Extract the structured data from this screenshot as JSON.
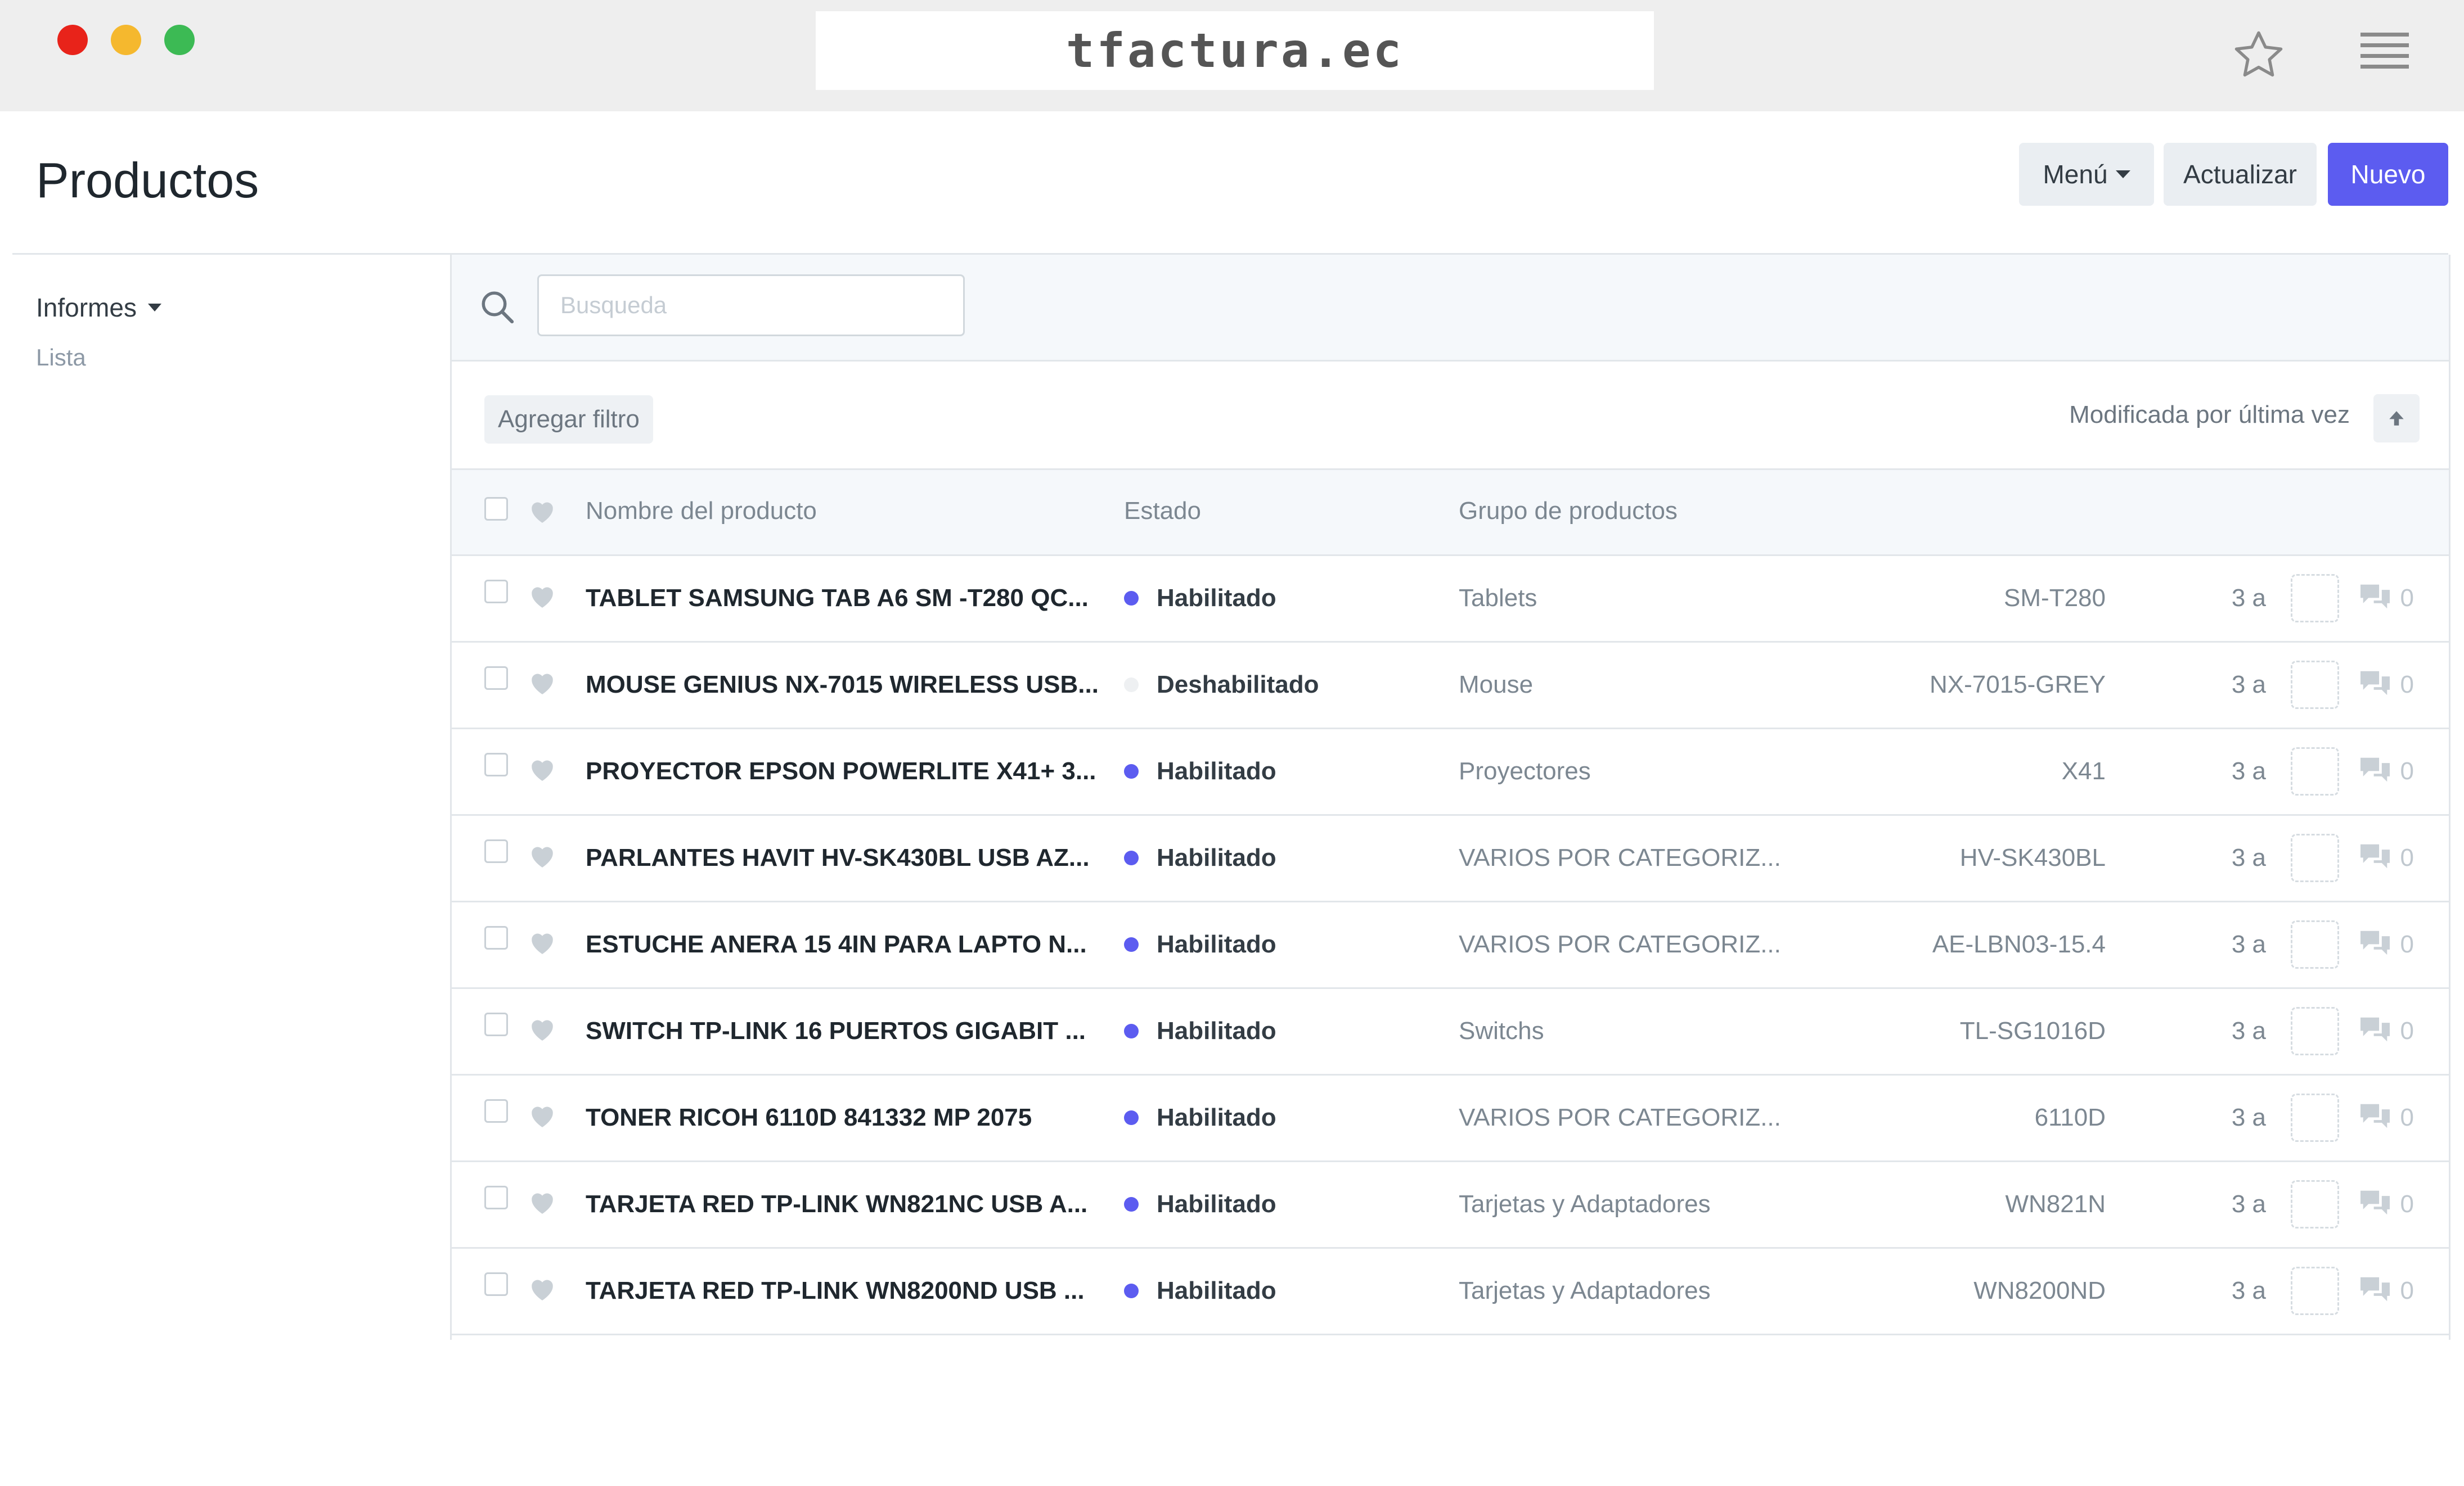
{
  "browser": {
    "url": "tfactura.ec",
    "icons": {
      "bookmark": "star-icon",
      "menu": "hamburger-icon"
    }
  },
  "header": {
    "title": "Productos",
    "menu_label": "Menú",
    "refresh_label": "Actualizar",
    "new_label": "Nuevo"
  },
  "sidebar": {
    "reports_label": "Informes",
    "list_label": "Lista"
  },
  "search": {
    "placeholder": "Busqueda"
  },
  "filters": {
    "add_filter_label": "Agregar filtro",
    "sort_label": "Modificada por última vez"
  },
  "columns": {
    "name": "Nombre del producto",
    "status": "Estado",
    "group": "Grupo de productos"
  },
  "colors": {
    "accent": "#5c5cf0",
    "enabled_dot": "#5c5cf0",
    "disabled_dot": "#eef0f2"
  },
  "rows": [
    {
      "name": "TABLET SAMSUNG TAB A6 SM -T280 QC...",
      "status": "Habilitado",
      "status_color": "#5c5cf0",
      "group": "Tablets",
      "code": "SM-T280",
      "age": "3 a",
      "comments": "0"
    },
    {
      "name": "MOUSE GENIUS NX-7015 WIRELESS USB...",
      "status": "Deshabilitado",
      "status_color": "#eef0f2",
      "group": "Mouse",
      "code": "NX-7015-GREY",
      "age": "3 a",
      "comments": "0"
    },
    {
      "name": "PROYECTOR EPSON POWERLITE X41+ 3...",
      "status": "Habilitado",
      "status_color": "#5c5cf0",
      "group": "Proyectores",
      "code": "X41",
      "age": "3 a",
      "comments": "0"
    },
    {
      "name": "PARLANTES HAVIT HV-SK430BL USB AZ...",
      "status": "Habilitado",
      "status_color": "#5c5cf0",
      "group": "VARIOS POR CATEGORIZ...",
      "code": "HV-SK430BL",
      "age": "3 a",
      "comments": "0"
    },
    {
      "name": "ESTUCHE ANERA 15 4IN PARA LAPTO N...",
      "status": "Habilitado",
      "status_color": "#5c5cf0",
      "group": "VARIOS POR CATEGORIZ...",
      "code": "AE-LBN03-15.4",
      "age": "3 a",
      "comments": "0"
    },
    {
      "name": "SWITCH TP-LINK 16 PUERTOS GIGABIT ...",
      "status": "Habilitado",
      "status_color": "#5c5cf0",
      "group": "Switchs",
      "code": "TL-SG1016D",
      "age": "3 a",
      "comments": "0"
    },
    {
      "name": "TONER RICOH 6110D 841332 MP 2075",
      "status": "Habilitado",
      "status_color": "#5c5cf0",
      "group": "VARIOS POR CATEGORIZ...",
      "code": "6110D",
      "age": "3 a",
      "comments": "0"
    },
    {
      "name": "TARJETA RED TP-LINK WN821NC USB A...",
      "status": "Habilitado",
      "status_color": "#5c5cf0",
      "group": "Tarjetas y Adaptadores",
      "code": "WN821N",
      "age": "3 a",
      "comments": "0"
    },
    {
      "name": "TARJETA RED TP-LINK WN8200ND USB ...",
      "status": "Habilitado",
      "status_color": "#5c5cf0",
      "group": "Tarjetas y Adaptadores",
      "code": "WN8200ND",
      "age": "3 a",
      "comments": "0"
    }
  ]
}
